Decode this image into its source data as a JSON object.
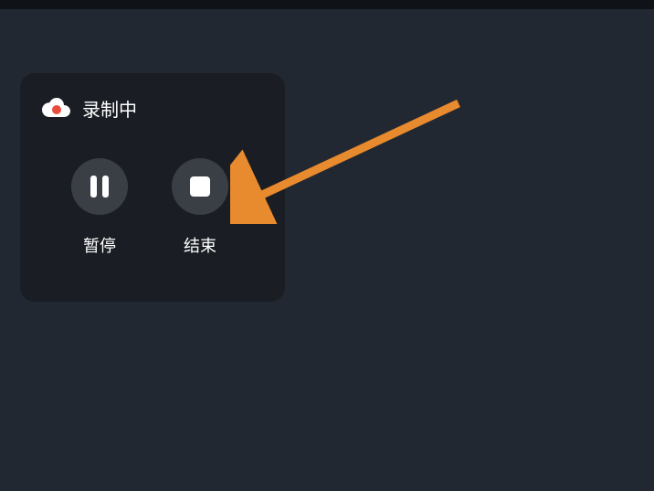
{
  "panel": {
    "title": "录制中",
    "pause_label": "暂停",
    "stop_label": "结束"
  },
  "annotation": {
    "arrow_color": "#e88a2e"
  }
}
